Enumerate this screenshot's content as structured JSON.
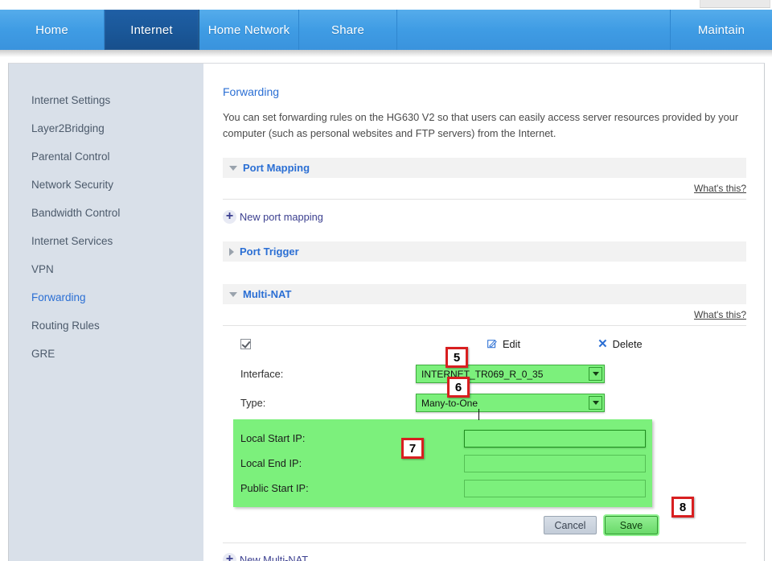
{
  "navbar": {
    "items": [
      {
        "label": "Home",
        "active": false
      },
      {
        "label": "Internet",
        "active": true
      },
      {
        "label": "Home Network",
        "active": false
      },
      {
        "label": "Share",
        "active": false
      },
      {
        "label": "Maintain",
        "active": false
      }
    ],
    "active_tab": "Internet",
    "bg_color": "#3f9ce4",
    "active_color": "#1a5798"
  },
  "sidebar": {
    "items": [
      {
        "label": "Internet Settings",
        "active": false
      },
      {
        "label": "Layer2Bridging",
        "active": false
      },
      {
        "label": "Parental Control",
        "active": false
      },
      {
        "label": "Network Security",
        "active": false
      },
      {
        "label": "Bandwidth Control",
        "active": false
      },
      {
        "label": "Internet Services",
        "active": false
      },
      {
        "label": "VPN",
        "active": false
      },
      {
        "label": "Forwarding",
        "active": true
      },
      {
        "label": "Routing Rules",
        "active": false
      },
      {
        "label": "GRE",
        "active": false
      }
    ],
    "active_item": "Forwarding",
    "bg_color": "#d9e0e9",
    "active_color": "#2b6fd4"
  },
  "main": {
    "title": "Forwarding",
    "description": "You can set forwarding rules on the HG630 V2 so that users can easily access server resources provided by your computer (such as personal websites and FTP servers) from the Internet."
  },
  "sections": {
    "port_mapping": {
      "title": "Port Mapping",
      "expanded": true,
      "caret": "caret-down-icon",
      "whats_this": "What's this?",
      "new_link": "New port mapping"
    },
    "port_trigger": {
      "title": "Port Trigger",
      "expanded": false,
      "caret": "caret-right-icon"
    },
    "multi_nat": {
      "title": "Multi-NAT",
      "expanded": true,
      "caret": "caret-down-icon",
      "whats_this": "What's this?",
      "new_link": "New Multi-NAT"
    }
  },
  "rule_actions": {
    "checkbox_checked": true,
    "edit_label": "Edit",
    "delete_label": "Delete"
  },
  "form": {
    "interface": {
      "label": "Interface:",
      "value": "INTERNET_TR069_R_0_35",
      "options": [
        "INTERNET_TR069_R_0_35"
      ]
    },
    "type": {
      "label": "Type:",
      "value": "Many-to-One",
      "options": [
        "Many-to-One"
      ]
    },
    "local_start_ip": {
      "label": "Local Start IP:",
      "value": "",
      "placeholder": "",
      "focused": true
    },
    "local_end_ip": {
      "label": "Local End IP:",
      "value": "",
      "placeholder": "",
      "focused": false
    },
    "public_start_ip": {
      "label": "Public Start IP:",
      "value": "",
      "placeholder": "",
      "focused": false
    },
    "highlight_color": "#7cf07c"
  },
  "buttons": {
    "cancel": "Cancel",
    "save": "Save"
  },
  "callouts": [
    {
      "number": "5",
      "target": "interface-dropdown"
    },
    {
      "number": "6",
      "target": "type-dropdown"
    },
    {
      "number": "7",
      "target": "ip-fields-panel"
    },
    {
      "number": "8",
      "target": "save-button"
    }
  ],
  "callout_color": "#d81f20"
}
